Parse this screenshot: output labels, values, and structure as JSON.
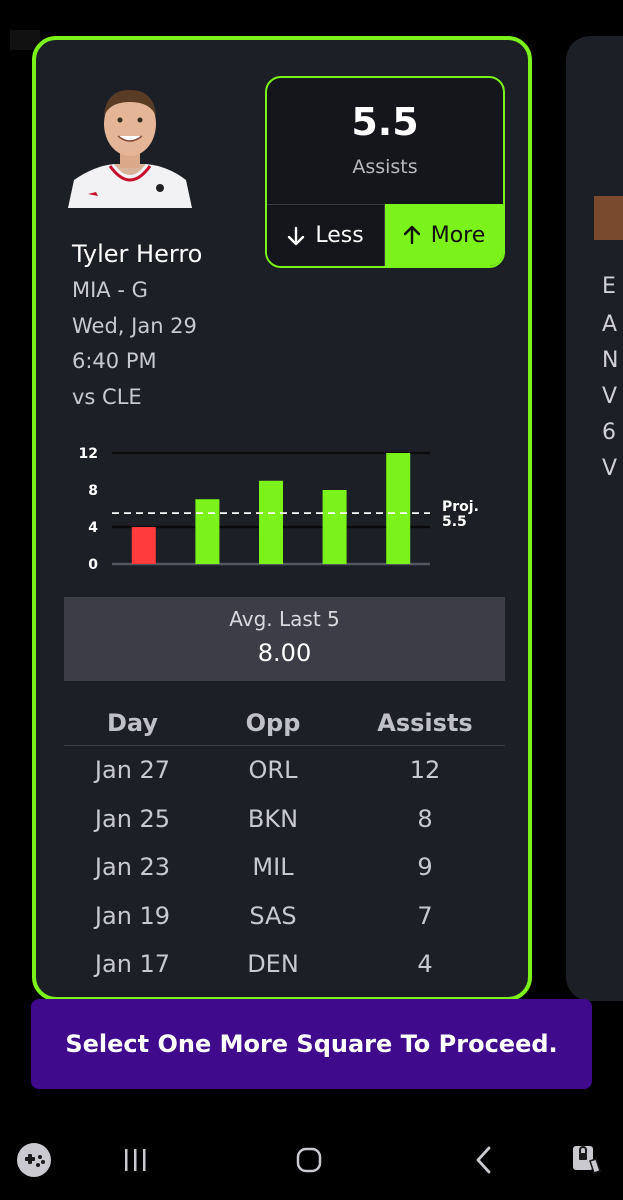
{
  "player": {
    "name": "Tyler Herro",
    "team_pos": "MIA - G",
    "date": "Wed, Jan 29",
    "time": "6:40 PM",
    "opponent": "vs CLE"
  },
  "line": {
    "value": "5.5",
    "stat": "Assists",
    "less_label": "Less",
    "more_label": "More"
  },
  "chart_data": {
    "type": "bar",
    "values": [
      4,
      7,
      9,
      8,
      12
    ],
    "colors": [
      "#ff3b3b",
      "#7bf21a",
      "#7bf21a",
      "#7bf21a",
      "#7bf21a"
    ],
    "ylim": [
      0,
      12
    ],
    "yticks": [
      "0",
      "4",
      "8",
      "12"
    ],
    "threshold_label_1": "Proj.",
    "threshold_label_2": "5.5",
    "threshold": 5.5
  },
  "avg": {
    "label": "Avg. Last 5",
    "value": "8.00"
  },
  "log": {
    "headers": [
      "Day",
      "Opp",
      "Assists"
    ],
    "rows": [
      [
        "Jan 27",
        "ORL",
        "12"
      ],
      [
        "Jan 25",
        "BKN",
        "8"
      ],
      [
        "Jan 23",
        "MIL",
        "9"
      ],
      [
        "Jan 19",
        "SAS",
        "7"
      ],
      [
        "Jan 17",
        "DEN",
        "4"
      ]
    ]
  },
  "toast": {
    "message": "Select One More Square To Proceed."
  },
  "colors": {
    "accent": "#7bf21a",
    "negative": "#ff3b3b",
    "toast_bg": "#3f0a8c",
    "card_bg": "#1d1f27"
  },
  "navbar": {
    "icons": [
      "game-launcher-icon",
      "recent-apps-icon",
      "home-icon",
      "back-icon",
      "assistant-icon"
    ]
  }
}
